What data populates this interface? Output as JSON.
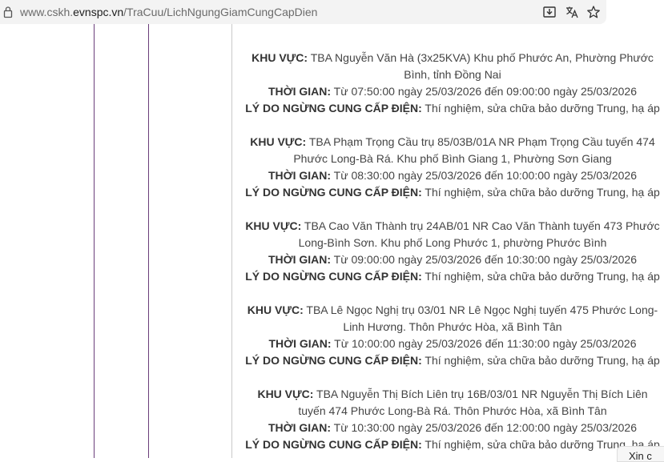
{
  "address_bar": {
    "url_prefix": "www.cskh.",
    "url_host": "evnspc.vn",
    "url_path": "/TraCuu/LichNgungGiamCungCapDien"
  },
  "labels": {
    "area": "KHU VỰC:",
    "time": "THỜI GIAN:",
    "reason": "LÝ DO NGỪNG CUNG CẤP ĐIỆN:"
  },
  "entries": [
    {
      "area_line1": " TBA Nguyễn Văn Hà (3x25KVA) Khu phố Phước An, Phường Phước",
      "area_line2": "Bình, tỉnh Đồng Nai",
      "time": " Từ 07:50:00 ngày 25/03/2026 đến 09:00:00 ngày 25/03/2026",
      "reason": " Thí nghiệm, sửa chữa bảo dưỡng Trung, hạ áp"
    },
    {
      "area_line1": " TBA Phạm Trọng Cầu trụ 85/03B/01A NR Phạm Trọng Cầu tuyến 474",
      "area_line2": "Phước Long-Bà Rá. Khu phố Bình Giang 1, Phường Sơn Giang",
      "time": " Từ 08:30:00 ngày 25/03/2026 đến 10:00:00 ngày 25/03/2026",
      "reason": " Thí nghiệm, sửa chữa bảo dưỡng Trung, hạ áp"
    },
    {
      "area_line1": " TBA Cao Văn Thành trụ 24AB/01 NR Cao Văn Thành tuyến 473 Phước",
      "area_line2": "Long-Bình Sơn. Khu phố Long Phước 1, phường Phước Bình",
      "time": " Từ 09:00:00 ngày 25/03/2026 đến 10:30:00 ngày 25/03/2026",
      "reason": " Thí nghiệm, sửa chữa bảo dưỡng Trung, hạ áp"
    },
    {
      "area_line1": " TBA Lê Ngọc Nghị trụ 03/01 NR Lê Ngọc Nghị tuyến 475 Phước Long-",
      "area_line2": "Linh Hương. Thôn Phước Hòa, xã Bình Tân",
      "time": " Từ 10:00:00 ngày 25/03/2026 đến 11:30:00 ngày 25/03/2026",
      "reason": " Thí nghiệm, sửa chữa bảo dưỡng Trung, hạ áp"
    },
    {
      "area_line1": " TBA Nguyễn Thị Bích Liên trụ 16B/03/01 NR Nguyễn Thị Bích Liên",
      "area_line2": "tuyến 474 Phước Long-Bà Rá. Thôn Phước Hòa, xã Bình Tân",
      "time": " Từ 10:30:00 ngày 25/03/2026 đến 12:00:00 ngày 25/03/2026",
      "reason": " Thí nghiệm, sửa chữa bảo dưỡng Trung, hạ áp"
    }
  ],
  "chat_widget": {
    "label": "Xin c"
  }
}
